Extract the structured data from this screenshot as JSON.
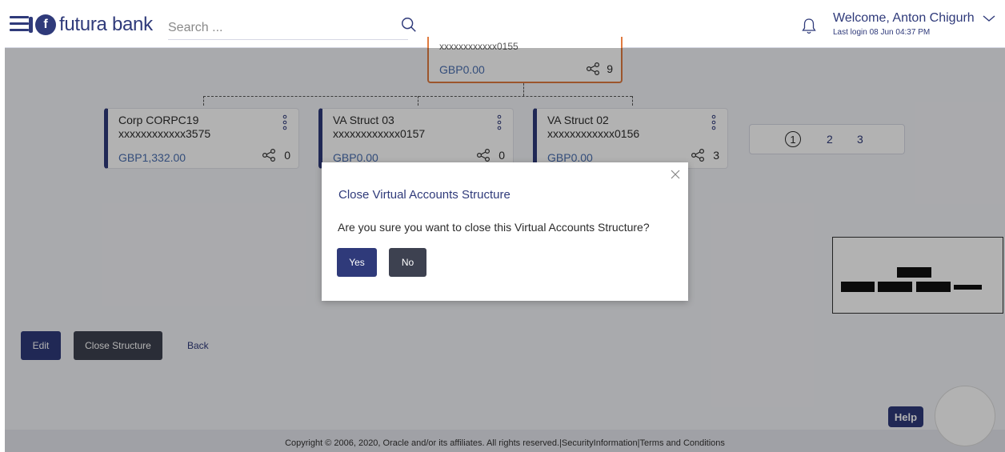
{
  "header": {
    "brand": "futura bank",
    "logo_glyph": "f",
    "search_placeholder": "Search ...",
    "welcome": "Welcome, Anton Chigurh",
    "last_login": "Last login 08 Jun 04:37 PM"
  },
  "structure": {
    "parent": {
      "number": "xxxxxxxxxxxx0155",
      "balance": "GBP0.00",
      "children": "9"
    },
    "children": [
      {
        "name": "Corp CORPC19",
        "number": "xxxxxxxxxxxx3575",
        "balance": "GBP1,332.00",
        "children": "0"
      },
      {
        "name": "VA Struct 03",
        "number": "xxxxxxxxxxxx0157",
        "balance": "GBP0.00",
        "children": "0"
      },
      {
        "name": "VA Struct 02",
        "number": "xxxxxxxxxxxx0156",
        "balance": "GBP0.00",
        "children": "3"
      }
    ]
  },
  "pagination": {
    "pages": [
      "1",
      "2",
      "3"
    ],
    "current": "1"
  },
  "actions": {
    "edit": "Edit",
    "close_structure": "Close Structure",
    "back": "Back"
  },
  "modal": {
    "title": "Close Virtual Accounts Structure",
    "message": "Are you sure you want to close this Virtual Accounts Structure?",
    "yes": "Yes",
    "no": "No"
  },
  "help": "Help",
  "footer": {
    "copyright": "Copyright © 2006, 2020, Oracle and/or its affiliates. All rights reserved.",
    "security": "SecurityInformation",
    "terms": "Terms and Conditions"
  },
  "colors": {
    "brand": "#2f3a7a",
    "parent_border": "#e07a3f",
    "balance": "#4a6fb0"
  }
}
